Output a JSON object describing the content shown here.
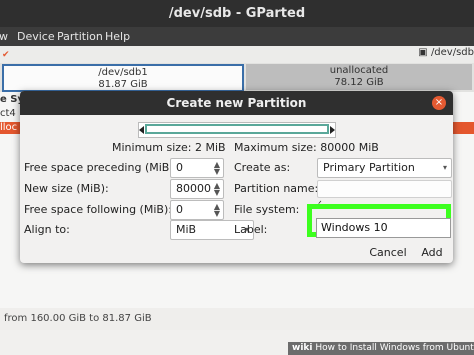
{
  "window": {
    "title": "/dev/sdb - GParted"
  },
  "menu": [
    "w",
    "Device",
    "Partition",
    "Help"
  ],
  "device_selector": {
    "label": "/dev/sdb"
  },
  "partition_map": {
    "seg1": {
      "name": "/dev/sdb1",
      "size": "81.87 GiB"
    },
    "seg2": {
      "name": "unallocated",
      "size": "78.12 GiB"
    }
  },
  "list_fragments": {
    "frag1": "e Sy",
    "frag2": "ct4",
    "frag3": "lloc"
  },
  "dialog": {
    "title": "Create new Partition",
    "close_symbol": "×",
    "min_size": "Minimum size: 2 MiB",
    "max_size": "Maximum size: 80000 MiB",
    "left": {
      "free_preceding_label": "Free space preceding (MiB):",
      "free_preceding_value": "0",
      "new_size_label": "New size (MiB):",
      "new_size_value": "80000",
      "free_following_label": "Free space following (MiB):",
      "free_following_value": "0",
      "align_label": "Align to:",
      "align_value": "MiB"
    },
    "right": {
      "create_as_label": "Create as:",
      "create_as_value": "Primary Partition",
      "partition_name_label": "Partition name:",
      "partition_name_value": "",
      "file_system_label": "File system:",
      "file_system_value": "ᐟ",
      "label_label": "Label:",
      "label_value": "Windows 10"
    },
    "buttons": {
      "cancel": "Cancel",
      "add": "Add"
    }
  },
  "status": {
    "text": "from 160.00 GiB to 81.87 GiB"
  },
  "watermark": {
    "prefix": "wiki",
    "text": "How to Install Windows from Ubuntu"
  },
  "colors": {
    "highlight": "#3cff1e",
    "selection": "#e4572e",
    "partition_border": "#3a6ea8"
  }
}
